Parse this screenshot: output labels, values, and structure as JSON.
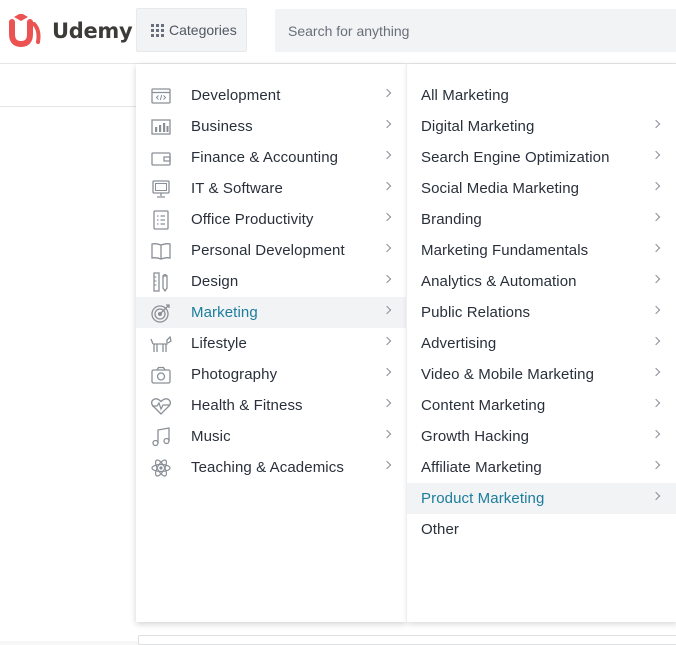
{
  "header": {
    "logo_text": "Udemy",
    "categories_label": "Categories",
    "search_placeholder": "Search for anything"
  },
  "categories": [
    {
      "label": "Development",
      "icon": "code-window-icon",
      "has_submenu": true
    },
    {
      "label": "Business",
      "icon": "bar-chart-icon",
      "has_submenu": true
    },
    {
      "label": "Finance & Accounting",
      "icon": "wallet-icon",
      "has_submenu": true
    },
    {
      "label": "IT & Software",
      "icon": "monitor-icon",
      "has_submenu": true
    },
    {
      "label": "Office Productivity",
      "icon": "checklist-icon",
      "has_submenu": true
    },
    {
      "label": "Personal Development",
      "icon": "open-book-icon",
      "has_submenu": true
    },
    {
      "label": "Design",
      "icon": "pencil-ruler-icon",
      "has_submenu": true
    },
    {
      "label": "Marketing",
      "icon": "target-icon",
      "has_submenu": true,
      "active": true
    },
    {
      "label": "Lifestyle",
      "icon": "dog-icon",
      "has_submenu": true
    },
    {
      "label": "Photography",
      "icon": "camera-icon",
      "has_submenu": true
    },
    {
      "label": "Health & Fitness",
      "icon": "heartbeat-icon",
      "has_submenu": true
    },
    {
      "label": "Music",
      "icon": "music-note-icon",
      "has_submenu": true
    },
    {
      "label": "Teaching & Academics",
      "icon": "atom-icon",
      "has_submenu": true
    }
  ],
  "subcategories": [
    {
      "label": "All Marketing",
      "has_submenu": false
    },
    {
      "label": "Digital Marketing",
      "has_submenu": true
    },
    {
      "label": "Search Engine Optimization",
      "has_submenu": true
    },
    {
      "label": "Social Media Marketing",
      "has_submenu": true
    },
    {
      "label": "Branding",
      "has_submenu": true
    },
    {
      "label": "Marketing Fundamentals",
      "has_submenu": true
    },
    {
      "label": "Analytics & Automation",
      "has_submenu": true
    },
    {
      "label": "Public Relations",
      "has_submenu": true
    },
    {
      "label": "Advertising",
      "has_submenu": true
    },
    {
      "label": "Video & Mobile Marketing",
      "has_submenu": true
    },
    {
      "label": "Content Marketing",
      "has_submenu": true
    },
    {
      "label": "Growth Hacking",
      "has_submenu": true
    },
    {
      "label": "Affiliate Marketing",
      "has_submenu": true
    },
    {
      "label": "Product Marketing",
      "has_submenu": true,
      "active": true
    },
    {
      "label": "Other",
      "has_submenu": false
    }
  ],
  "colors": {
    "brand": "#ec5252",
    "active_text": "#1c7d9c",
    "text": "#29303b"
  }
}
